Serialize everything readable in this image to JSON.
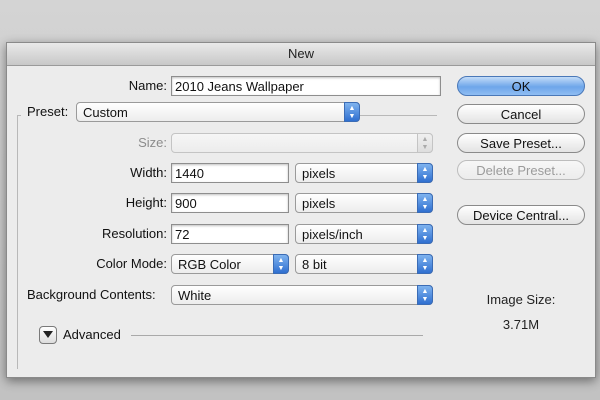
{
  "dialog": {
    "title": "New"
  },
  "form": {
    "name_label": "Name:",
    "name_value": "2010 Jeans Wallpaper",
    "preset_label": "Preset:",
    "preset_value": "Custom",
    "size_label": "Size:",
    "size_value": "",
    "width_label": "Width:",
    "width_value": "1440",
    "width_unit": "pixels",
    "height_label": "Height:",
    "height_value": "900",
    "height_unit": "pixels",
    "resolution_label": "Resolution:",
    "resolution_value": "72",
    "resolution_unit": "pixels/inch",
    "color_mode_label": "Color Mode:",
    "color_mode_value": "RGB Color",
    "bit_depth_value": "8 bit",
    "background_label": "Background Contents:",
    "background_value": "White",
    "advanced_label": "Advanced"
  },
  "buttons": {
    "ok": "OK",
    "cancel": "Cancel",
    "save_preset": "Save Preset...",
    "delete_preset": "Delete Preset...",
    "device_central": "Device Central..."
  },
  "image_size": {
    "label": "Image Size:",
    "value": "3.71M"
  },
  "icons": {
    "popup_arrows": "updown-arrows-icon",
    "disclosure": "disclosure-triangle-icon"
  },
  "colors": {
    "accent": "#4f8fe6",
    "dialog_bg": "#ececec"
  }
}
